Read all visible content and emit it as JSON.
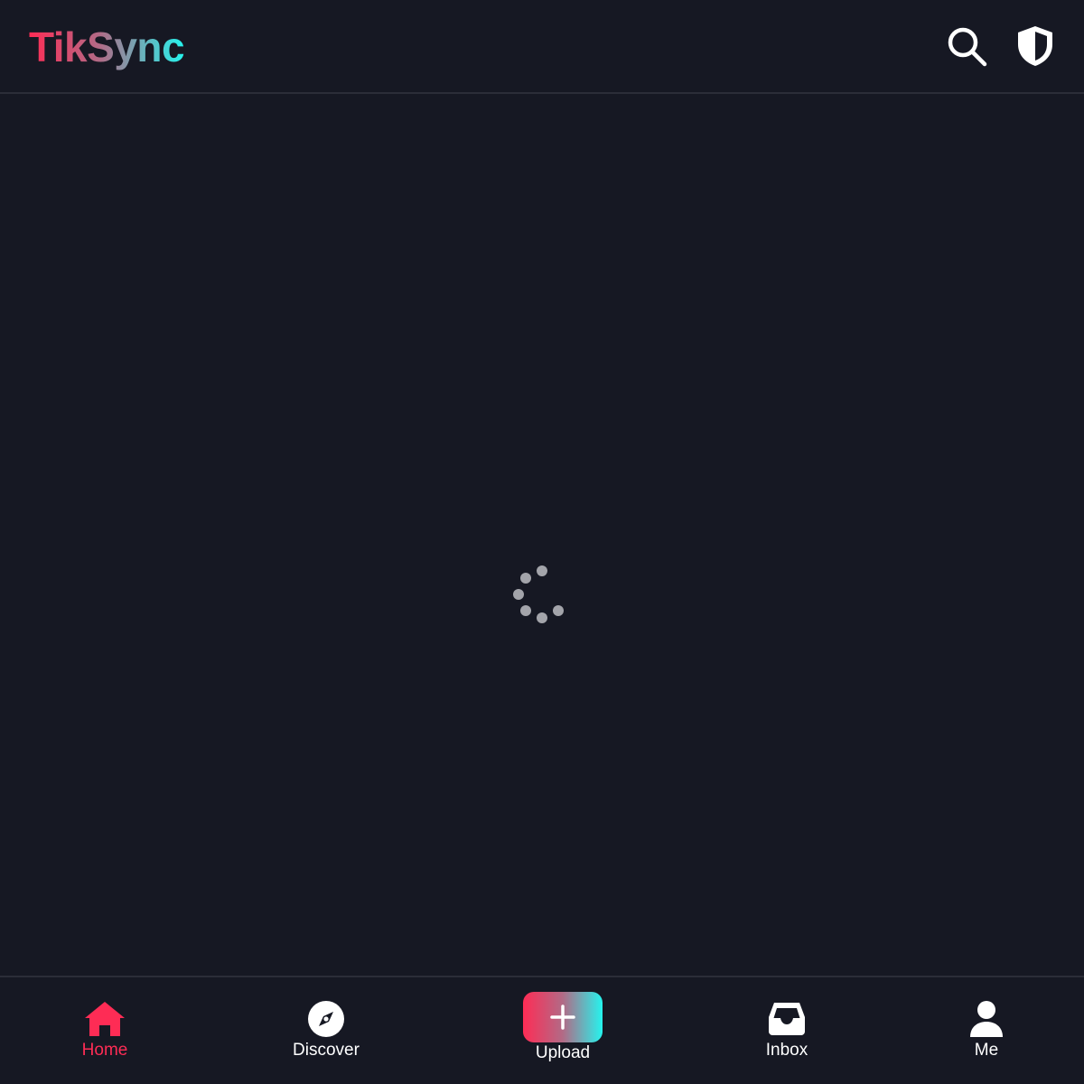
{
  "header": {
    "logo_text": "TikSync",
    "search_icon": "search-icon",
    "shield_icon": "shield-icon"
  },
  "content": {
    "state": "loading",
    "spinner_icon": "loading-spinner-icon"
  },
  "bottom_nav": {
    "items": [
      {
        "label": "Home",
        "icon": "home-icon",
        "active": true
      },
      {
        "label": "Discover",
        "icon": "compass-icon",
        "active": false
      },
      {
        "label": "Upload",
        "icon": "plus-icon",
        "active": false
      },
      {
        "label": "Inbox",
        "icon": "inbox-icon",
        "active": false
      },
      {
        "label": "Me",
        "icon": "user-icon",
        "active": false
      }
    ]
  },
  "colors": {
    "background": "#161823",
    "accent_red": "#fe2c55",
    "accent_cyan": "#25f4ee",
    "divider": "#2b2d38",
    "spinner_dot": "#a3a4aa"
  }
}
